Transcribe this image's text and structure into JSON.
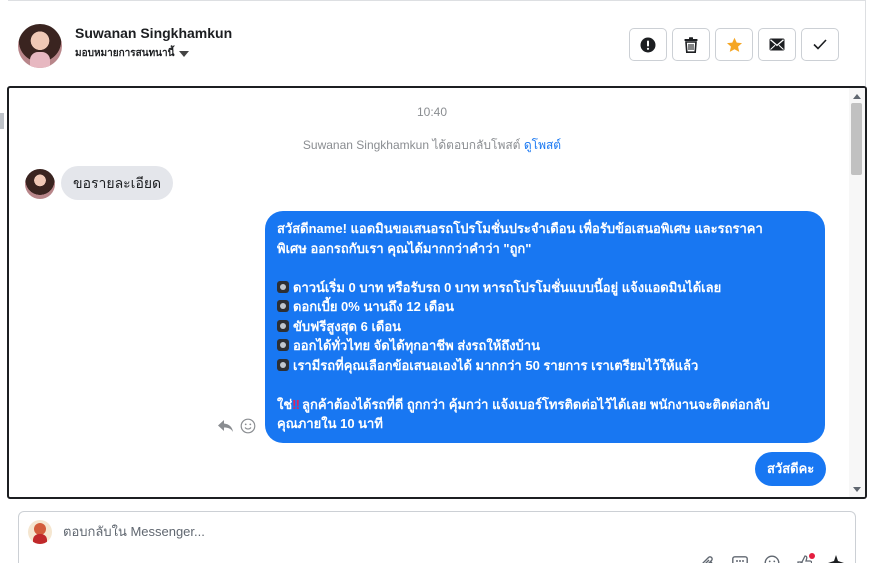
{
  "header": {
    "contact_name": "Suwanan Singkhamkun",
    "assign_label": "มอบหมายการสนทนานี้",
    "actions": [
      {
        "name": "report-button",
        "icon": "exclamation-circle-icon"
      },
      {
        "name": "delete-button",
        "icon": "trash-icon"
      },
      {
        "name": "star-button",
        "icon": "star-icon"
      },
      {
        "name": "mark-unread-button",
        "icon": "envelope-icon"
      },
      {
        "name": "mark-done-button",
        "icon": "check-icon"
      }
    ]
  },
  "conversation": {
    "timestamp": "10:40",
    "reply_notice": "Suwanan Singkhamkun ได้ตอบกลับโพสต์",
    "reply_notice_link": "ดูโพสต์",
    "incoming_message": "ขอรายละเอียด",
    "outgoing_message": {
      "intro_1": "สวัสดีname! แอดมินขอเสนอรถโปรโมชั่นประจำเดือน เพื่อรับข้อเสนอพิเศษ และรถราคา",
      "intro_2": "พิเศษ ออกรถกับเรา คุณได้มากกว่าคำว่า \"ถูก\"",
      "bullets": [
        "ดาวน์เริ่ม 0 บาท หรือรับรถ 0 บาท หารถโปรโมชั่นแบบนี้อยู่ แจ้งแอดมินได้เลย",
        "ดอกเบี้ย 0% นานถึง 12 เดือน",
        "ขับฟรีสูงสุด 6 เดือน",
        "ออกได้ทั่วไทย จัดได้ทุกอาชีพ ส่งรถให้ถึงบ้าน",
        "เรามีรถที่คุณเลือกข้อเสนอเองได้ มากกว่า 50 รายการ เราเตรียมไว้ให้แล้ว"
      ],
      "closing_prefix": "ใช่",
      "closing_1": "ลูกค้าต้องได้รถที่ดี ถูกกว่า คุ้มกว่า แจ้งเบอร์โทรติดต่อไว้ได้เลย พนักงานจะติดต่อกลับ",
      "closing_2": "คุณภายใน 10 นาที"
    },
    "outgoing_short": "สวัสดีคะ"
  },
  "composer": {
    "placeholder": "ตอบกลับใน Messenger..."
  },
  "colors": {
    "accent": "#1877f2",
    "star": "#f5a623"
  }
}
